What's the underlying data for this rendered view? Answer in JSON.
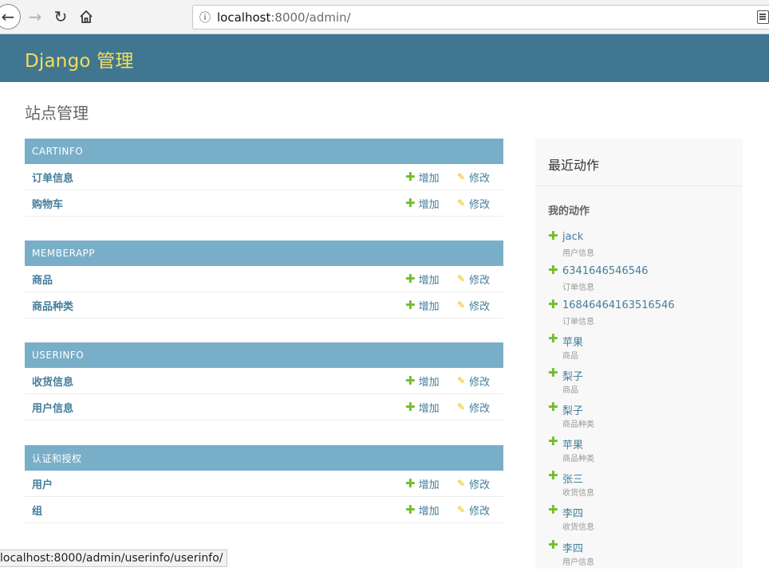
{
  "browser": {
    "url_host": "localhost",
    "url_rest": ":8000/admin/",
    "status_url": "localhost:8000/admin/userinfo/userinfo/"
  },
  "header": {
    "branding": "Django 管理"
  },
  "page": {
    "title": "站点管理"
  },
  "links": {
    "add": "增加",
    "change": "修改"
  },
  "modules": [
    {
      "caption": "CARTINFO",
      "models": [
        "订单信息",
        "购物车"
      ]
    },
    {
      "caption": "MEMBERAPP",
      "models": [
        "商品",
        "商品种类"
      ]
    },
    {
      "caption": "USERINFO",
      "models": [
        "收货信息",
        "用户信息"
      ]
    },
    {
      "caption": "认证和授权",
      "models": [
        "用户",
        "组"
      ]
    }
  ],
  "recent": {
    "title": "最近动作",
    "subtitle": "我的动作",
    "actions": [
      {
        "name": "jack",
        "type": "用户信息"
      },
      {
        "name": "6341646546546",
        "type": "订单信息"
      },
      {
        "name": "16846464163516546",
        "type": "订单信息"
      },
      {
        "name": "苹果",
        "type": "商品"
      },
      {
        "name": "梨子",
        "type": "商品"
      },
      {
        "name": "梨子",
        "type": "商品种类"
      },
      {
        "name": "苹果",
        "type": "商品种类"
      },
      {
        "name": "张三",
        "type": "收货信息"
      },
      {
        "name": "李四",
        "type": "收货信息"
      },
      {
        "name": "李四",
        "type": "用户信息"
      }
    ]
  },
  "colors": {
    "header_bg": "#417690",
    "branding": "#f5dd5d",
    "caption_bg": "#79aec8",
    "link": "#447e9b",
    "add_icon": "#70bf2b",
    "change_icon": "#efb80b"
  },
  "icons": {
    "back": "arrow-left-icon",
    "forward": "arrow-right-icon",
    "reload": "reload-icon",
    "home": "home-icon",
    "info": "info-icon",
    "reader": "reader-view-icon",
    "add": "plus-icon",
    "change": "pencil-icon"
  }
}
